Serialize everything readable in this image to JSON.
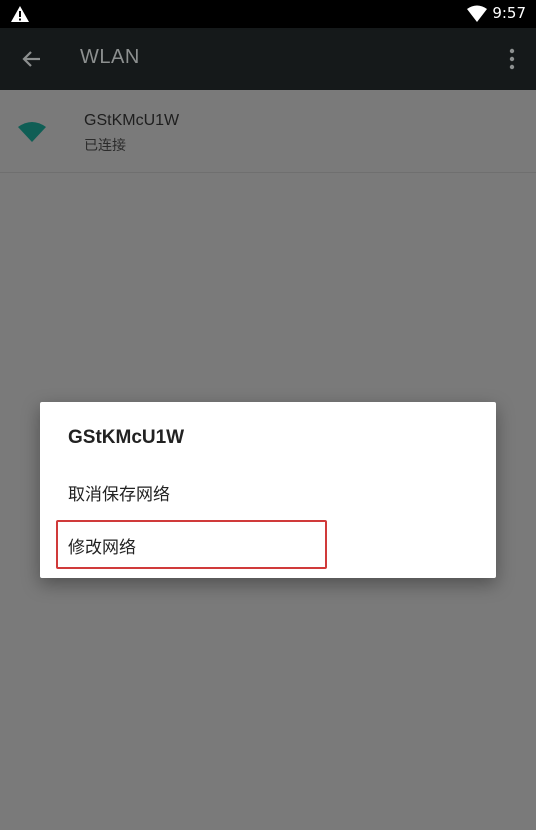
{
  "status_bar": {
    "time": "9:57",
    "icons": [
      "warning-icon",
      "wifi-icon"
    ]
  },
  "toolbar": {
    "title": "WLAN",
    "back_icon": "arrow-left-icon",
    "menu_icon": "more-vert-icon"
  },
  "network_list": [
    {
      "name": "GStKMcU1W",
      "status": "已连接",
      "icon": "wifi-signal-icon",
      "icon_color": "#0f5e55"
    }
  ],
  "dialog": {
    "title": "GStKMcU1W",
    "options": [
      {
        "label": "取消保存网络"
      },
      {
        "label": "修改网络"
      }
    ],
    "highlight_color": "#d03a3a"
  }
}
